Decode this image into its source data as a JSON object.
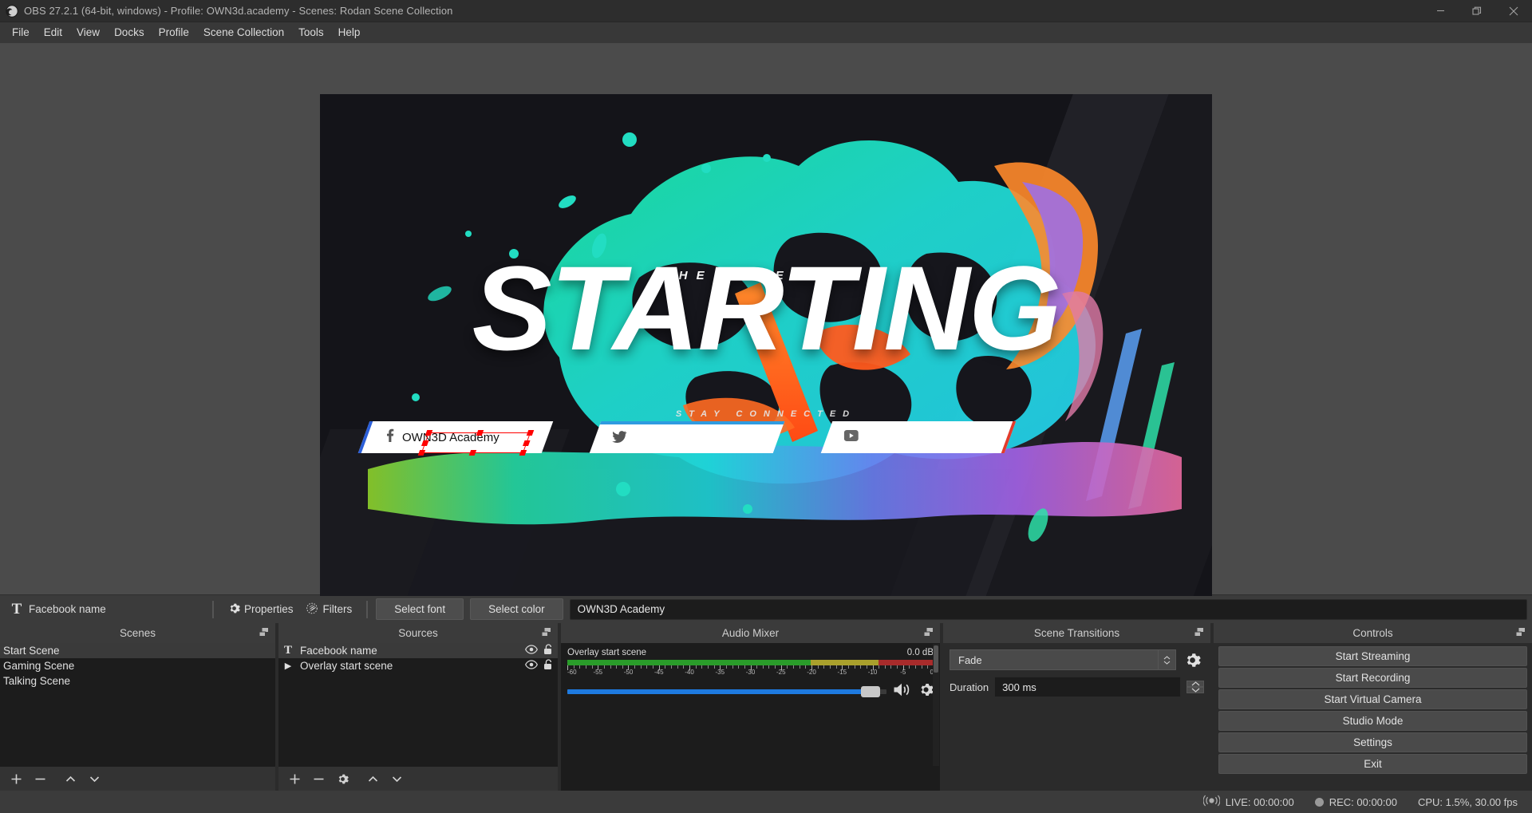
{
  "titlebar": {
    "title": "OBS 27.2.1 (64-bit, windows) - Profile: OWN3d.academy - Scenes: Rodan Scene Collection",
    "logo_icon": "obs-logo-icon",
    "minimize_icon": "minimize-icon",
    "restore_icon": "restore-icon",
    "close_icon": "close-icon"
  },
  "menubar": {
    "items": [
      {
        "label": "File"
      },
      {
        "label": "Edit"
      },
      {
        "label": "View"
      },
      {
        "label": "Docks"
      },
      {
        "label": "Profile"
      },
      {
        "label": "Scene Collection"
      },
      {
        "label": "Tools"
      },
      {
        "label": "Help"
      }
    ]
  },
  "preview": {
    "overlay_top_text": "THE STREAM IS",
    "overlay_main_text": "STARTING",
    "overlay_bottom_text": "STAY CONNECTED",
    "social_bars": [
      {
        "icon": "facebook-icon",
        "glyph": "f",
        "text": "OWN3D Academy",
        "accent": "#2b5fd9",
        "selected": true
      },
      {
        "icon": "twitter-icon",
        "glyph": "",
        "text": "",
        "accent": "#2f9be0",
        "selected": false
      },
      {
        "icon": "youtube-icon",
        "glyph": "",
        "text": "",
        "accent": "#e23b2b",
        "selected": false
      }
    ],
    "selection_color": "#ff0000"
  },
  "source_toolbar": {
    "type_icon": "text-source-icon",
    "type_glyph": "T",
    "source_name": "Facebook name",
    "properties_label": "Properties",
    "properties_icon": "gear-icon",
    "filters_label": "Filters",
    "filters_icon": "filters-icon",
    "select_font_label": "Select font",
    "select_color_label": "Select color",
    "text_value": "OWN3D Academy"
  },
  "scenes": {
    "title": "Scenes",
    "float_icon": "undock-icon",
    "items": [
      {
        "label": "Start Scene",
        "selected": true
      },
      {
        "label": "Gaming Scene",
        "selected": false
      },
      {
        "label": "Talking Scene",
        "selected": false
      }
    ],
    "footer": [
      {
        "name": "add-scene-button",
        "icon": "plus-icon"
      },
      {
        "name": "remove-scene-button",
        "icon": "minus-icon"
      },
      {
        "name": "move-scene-up-button",
        "icon": "chevron-up-icon"
      },
      {
        "name": "move-scene-down-button",
        "icon": "chevron-down-icon"
      }
    ]
  },
  "sources": {
    "title": "Sources",
    "float_icon": "undock-icon",
    "items": [
      {
        "label": "Facebook name",
        "icon": "text-source-icon",
        "glyph": "T",
        "visible": true,
        "locked": false,
        "selected": true
      },
      {
        "label": "Overlay start scene",
        "icon": "media-source-icon",
        "glyph": "▶",
        "visible": true,
        "locked": false,
        "selected": false
      }
    ],
    "footer": [
      {
        "name": "add-source-button",
        "icon": "plus-icon"
      },
      {
        "name": "remove-source-button",
        "icon": "minus-icon"
      },
      {
        "name": "source-properties-button",
        "icon": "gear-icon"
      },
      {
        "name": "move-source-up-button",
        "icon": "chevron-up-icon"
      },
      {
        "name": "move-source-down-button",
        "icon": "chevron-down-icon"
      }
    ]
  },
  "audio_mixer": {
    "title": "Audio Mixer",
    "float_icon": "undock-icon",
    "channels": [
      {
        "name": "Overlay start scene",
        "db_value": "0.0 dB",
        "meter": {
          "green_pct": 66.5,
          "yellow_pct": 18.5,
          "red_pct": 15.0
        },
        "scale_min": -60,
        "scale_max": 0,
        "scale_labels": [
          "-60",
          "-55",
          "-50",
          "-45",
          "-40",
          "-35",
          "-30",
          "-25",
          "-20",
          "-15",
          "-10",
          "-5",
          "0"
        ],
        "volume_pct": 95,
        "mute_icon": "speaker-icon",
        "settings_icon": "gear-icon"
      }
    ]
  },
  "scene_transitions": {
    "title": "Scene Transitions",
    "float_icon": "undock-icon",
    "transition_value": "Fade",
    "transition_options": [
      "Fade"
    ],
    "config_icon": "gear-icon",
    "duration_label": "Duration",
    "duration_value": "300 ms"
  },
  "controls": {
    "title": "Controls",
    "float_icon": "undock-icon",
    "buttons": [
      {
        "label": "Start Streaming",
        "name": "start-streaming-button"
      },
      {
        "label": "Start Recording",
        "name": "start-recording-button"
      },
      {
        "label": "Start Virtual Camera",
        "name": "start-virtual-camera-button"
      },
      {
        "label": "Studio Mode",
        "name": "studio-mode-button"
      },
      {
        "label": "Settings",
        "name": "settings-button"
      },
      {
        "label": "Exit",
        "name": "exit-button"
      }
    ]
  },
  "statusbar": {
    "live_icon": "broadcast-icon",
    "live_label": "LIVE: 00:00:00",
    "rec_icon": "record-dot-icon",
    "rec_label": "REC: 00:00:00",
    "cpu_label": "CPU: 1.5%, 30.00 fps"
  },
  "colors": {
    "accent_blue": "#1e7ae0",
    "meter_green": "#2a9c2a",
    "meter_yellow": "#a9a02c",
    "meter_red": "#a82b2b",
    "selection_red": "#ff0000",
    "splash_teal": "#20e0c0",
    "splash_orange": "#ff5a1e",
    "splash_purple": "#8b5cf6"
  }
}
